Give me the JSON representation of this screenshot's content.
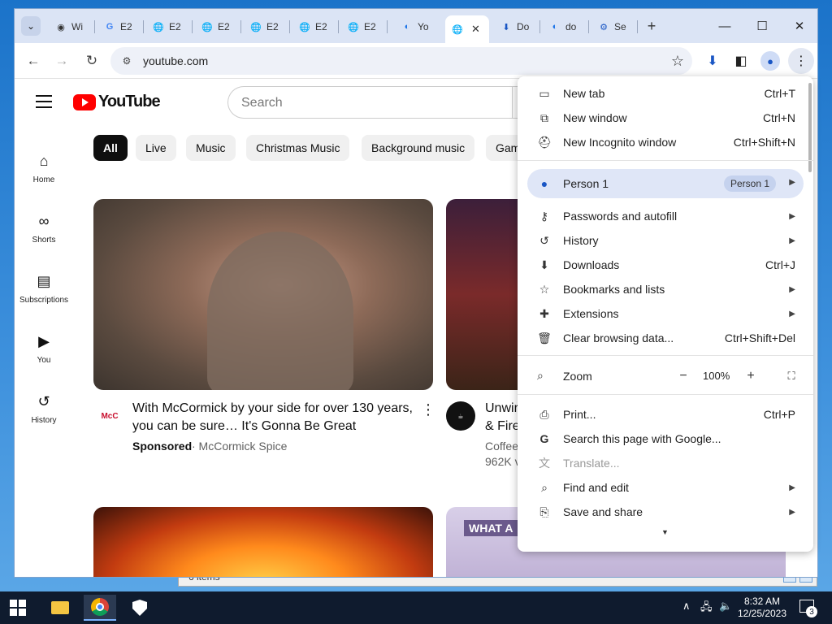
{
  "tabs": [
    {
      "label": "Wi",
      "icon": "github-icon"
    },
    {
      "label": "E2",
      "icon": "google-icon"
    },
    {
      "label": "E2",
      "icon": "globe-icon"
    },
    {
      "label": "E2",
      "icon": "globe-icon"
    },
    {
      "label": "E2",
      "icon": "globe-icon"
    },
    {
      "label": "E2",
      "icon": "globe-icon"
    },
    {
      "label": "E2",
      "icon": "globe-icon"
    },
    {
      "label": "Yo",
      "icon": "edge-icon"
    },
    {
      "label": "",
      "icon": "globe-icon",
      "active": true
    },
    {
      "label": "Do",
      "icon": "download-icon"
    },
    {
      "label": "do",
      "icon": "edge-icon"
    },
    {
      "label": "Se",
      "icon": "settings-icon"
    }
  ],
  "address_bar": {
    "url": "youtube.com"
  },
  "youtube": {
    "logo_text": "YouTube",
    "search_placeholder": "Search",
    "sidebar": [
      {
        "label": "Home",
        "icon": "home-icon"
      },
      {
        "label": "Shorts",
        "icon": "shorts-icon"
      },
      {
        "label": "Subscriptions",
        "icon": "subscriptions-icon"
      },
      {
        "label": "You",
        "icon": "you-icon"
      },
      {
        "label": "History",
        "icon": "history-icon"
      }
    ],
    "chips": [
      "All",
      "Live",
      "Music",
      "Christmas Music",
      "Background music",
      "Gam"
    ],
    "videos": [
      {
        "title_line1": "With McCormick by your side for over 130 years,",
        "title_line2": "you can be sure… It's Gonna Be Great",
        "sponsored": "Sponsored",
        "channel": "· McCormick Spice"
      },
      {
        "title_line1": "Unwir",
        "title_line2": "& Fire",
        "channel": "Coffee",
        "views": "962K v"
      }
    ],
    "thumb4_caption": "WHAT A"
  },
  "chrome_menu": {
    "group1": [
      {
        "label": "New tab",
        "shortcut": "Ctrl+T",
        "icon": "new-tab-icon"
      },
      {
        "label": "New window",
        "shortcut": "Ctrl+N",
        "icon": "new-window-icon"
      },
      {
        "label": "New Incognito window",
        "shortcut": "Ctrl+Shift+N",
        "icon": "incognito-icon"
      }
    ],
    "person": {
      "label": "Person 1",
      "badge": "Person 1"
    },
    "group2": [
      {
        "label": "Passwords and autofill",
        "icon": "key-icon",
        "submenu": true
      },
      {
        "label": "History",
        "icon": "history-icon",
        "submenu": true
      },
      {
        "label": "Downloads",
        "shortcut": "Ctrl+J",
        "icon": "download-icon"
      },
      {
        "label": "Bookmarks and lists",
        "icon": "star-icon",
        "submenu": true
      },
      {
        "label": "Extensions",
        "icon": "extensions-icon",
        "submenu": true
      },
      {
        "label": "Clear browsing data...",
        "shortcut": "Ctrl+Shift+Del",
        "icon": "trash-icon"
      }
    ],
    "zoom": {
      "label": "Zoom",
      "value": "100%"
    },
    "group3": [
      {
        "label": "Print...",
        "shortcut": "Ctrl+P",
        "icon": "print-icon"
      },
      {
        "label": "Search this page with Google...",
        "icon": "google-icon"
      },
      {
        "label": "Translate...",
        "icon": "translate-icon",
        "disabled": true
      },
      {
        "label": "Find and edit",
        "icon": "find-icon",
        "submenu": true
      },
      {
        "label": "Save and share",
        "icon": "save-icon",
        "submenu": true
      }
    ]
  },
  "taskbar": {
    "time": "8:32 AM",
    "date": "12/25/2023",
    "notification_count": "3"
  },
  "explorer_status": "6 items"
}
